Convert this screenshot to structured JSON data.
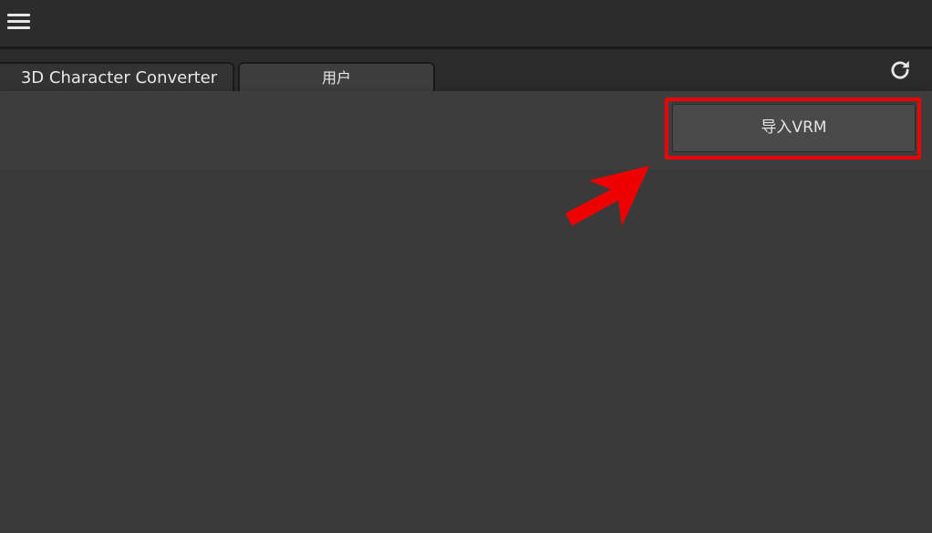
{
  "tabs": [
    {
      "label": "3D Character Converter"
    },
    {
      "label": "用户"
    }
  ],
  "toolbar": {
    "import_label": "导入VRM"
  },
  "icons": {
    "menu": "hamburger-menu-icon",
    "refresh": "refresh-icon",
    "annotation": "red-arrow"
  },
  "colors": {
    "highlight": "#ee0000",
    "background": "#2b2b2b",
    "panel": "#3d3d3d"
  }
}
